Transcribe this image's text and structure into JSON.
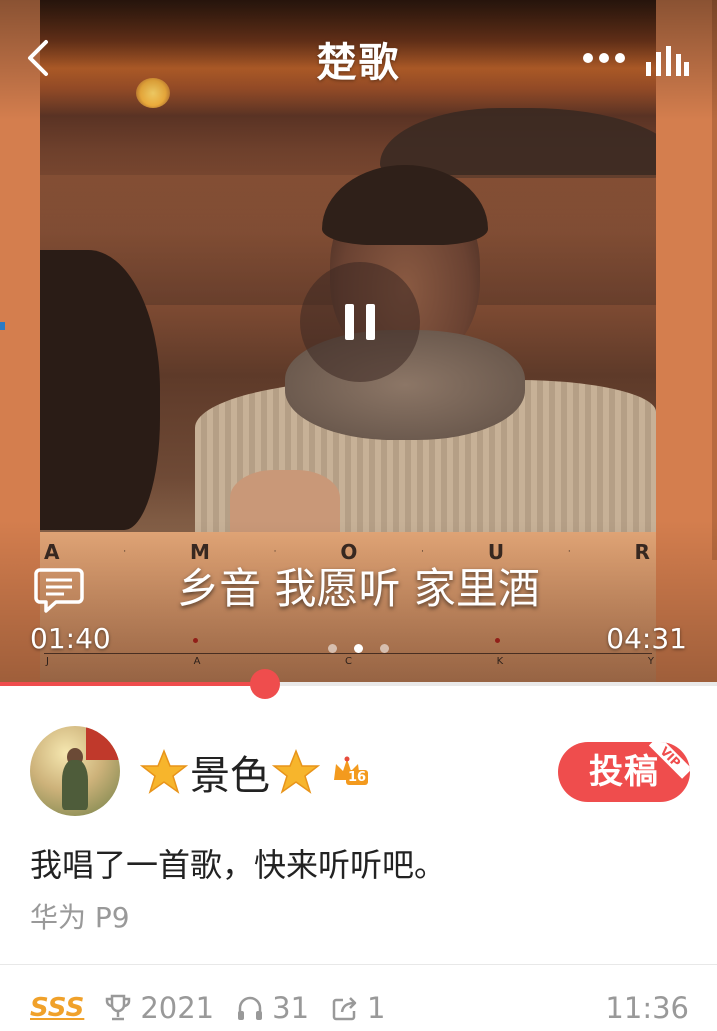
{
  "header": {
    "title": "楚歌"
  },
  "cover": {
    "top_letters": [
      "A",
      "M",
      "O",
      "U",
      "R"
    ],
    "bottom_letters": [
      "J",
      "A",
      "C",
      "K",
      "Y"
    ]
  },
  "player": {
    "state": "playing",
    "lyric": "乡音 我愿听 家里酒",
    "elapsed": "01:40",
    "total": "04:31",
    "progress_fraction": 0.37,
    "pager": {
      "count": 3,
      "active_index": 1
    }
  },
  "user": {
    "name": "景色",
    "level": "16",
    "submit_label": "投稿",
    "submit_badge": "VIP"
  },
  "post": {
    "description": "我唱了一首歌，快来听听吧。",
    "device": "华为 P9"
  },
  "stats": {
    "rating": "SSS",
    "trophies": "2021",
    "listens": "31",
    "shares": "1",
    "time": "11:36"
  },
  "colors": {
    "accent": "#ef4d4d",
    "rating": "#f0a12a",
    "muted_text": "#999999"
  }
}
